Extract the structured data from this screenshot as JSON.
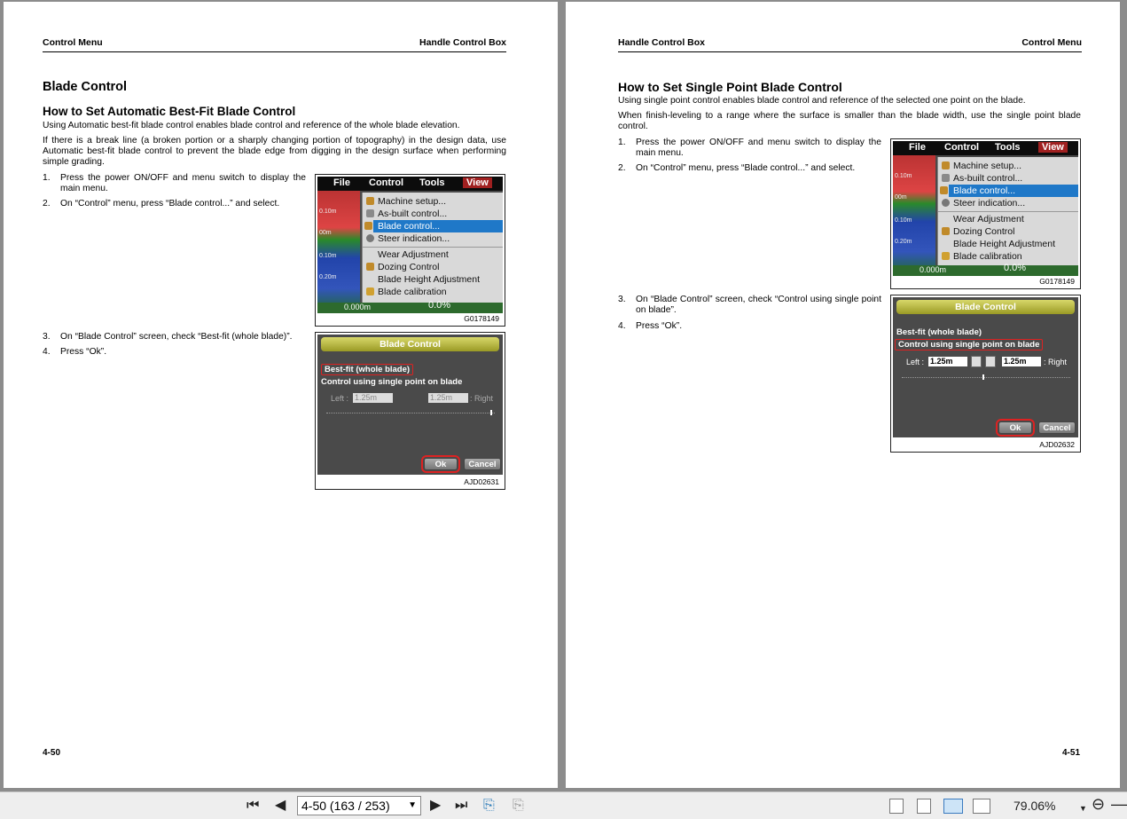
{
  "left_page": {
    "header_left": "Control Menu",
    "header_right": "Handle Control Box",
    "h1": "Blade Control",
    "h2": "How to Set Automatic Best-Fit Blade Control",
    "para1": "Using Automatic best-fit blade control enables blade control and reference of the whole blade elevation.",
    "para2": "If there is a break line (a broken portion or a sharply changing portion of topography) in the design data, use Automatic best-fit blade control to prevent the blade edge from digging in the design surface when performing simple grading.",
    "steps": [
      {
        "n": "1.",
        "t": "Press the power ON/OFF and menu switch to display the main menu."
      },
      {
        "n": "2.",
        "t": "On “Control” menu, press “Blade control...” and select."
      },
      {
        "n": "3.",
        "t": "On “Blade Control” screen, check “Best-fit (whole blade)”."
      },
      {
        "n": "4.",
        "t": "Press “Ok”."
      }
    ],
    "page_number": "4-50"
  },
  "right_page": {
    "header_left": "Handle Control Box",
    "header_right": "Control Menu",
    "h2": "How to Set Single Point Blade Control",
    "para1": "Using single point control enables blade control and reference of the selected one point on the blade.",
    "para2": "When finish-leveling to a range where the surface is smaller than the blade width, use the single point blade control.",
    "steps": [
      {
        "n": "1.",
        "t": "Press the power ON/OFF and menu switch to display the main menu."
      },
      {
        "n": "2.",
        "t": "On “Control” menu, press “Blade control...” and select."
      },
      {
        "n": "3.",
        "t": "On “Blade Control” screen, check “Control using single point on blade”."
      },
      {
        "n": "4.",
        "t": "Press “Ok”."
      }
    ],
    "page_number": "4-51"
  },
  "menu_figure": {
    "menubar": [
      "File",
      "Control",
      "Tools",
      "View"
    ],
    "items": [
      "Machine setup...",
      "As-built control...",
      "Blade control...",
      "Steer indication...",
      "Wear Adjustment",
      "Dozing Control",
      "Blade Height Adjustment",
      "Blade calibration"
    ],
    "gauge_labels": [
      "0.10m",
      "00m",
      "0.10m",
      "0.20m"
    ],
    "bottom_readout": "0.000m",
    "percent": "0.0%",
    "code": "G0178149"
  },
  "blade_dialog_left": {
    "title": "Blade Control",
    "opt1": "Best-fit (whole blade)",
    "opt2": "Control using single point on blade",
    "left_label": "Left :",
    "right_label": ": Right",
    "left_val": "1.25m",
    "right_val": "1.25m",
    "ok": "Ok",
    "cancel": "Cancel",
    "code": "AJD02631"
  },
  "blade_dialog_right": {
    "title": "Blade Control",
    "opt1": "Best-fit (whole blade)",
    "opt2": "Control using single point on blade",
    "left_label": "Left :",
    "right_label": ": Right",
    "left_val": "1.25m",
    "right_val": "1.25m",
    "ok": "Ok",
    "cancel": "Cancel",
    "code": "AJD02632"
  },
  "toolbar": {
    "page_field": "4-50 (163 / 253)",
    "zoom": "79.06%"
  }
}
